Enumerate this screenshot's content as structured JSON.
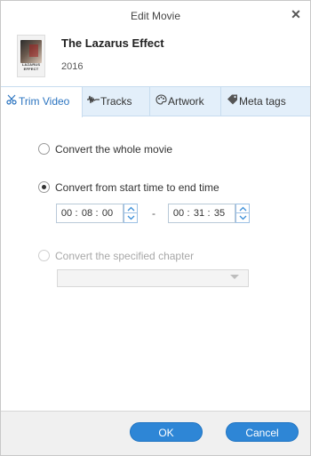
{
  "window": {
    "title": "Edit Movie",
    "close_icon": "close-icon"
  },
  "movie": {
    "title": "The Lazarus Effect",
    "year": "2016",
    "poster_text": "LAZARUS EFFECT"
  },
  "tabs": [
    {
      "label": "Trim Video",
      "icon": "scissors-icon",
      "active": true
    },
    {
      "label": "Tracks",
      "icon": "waveform-icon",
      "active": false
    },
    {
      "label": "Artwork",
      "icon": "palette-icon",
      "active": false
    },
    {
      "label": "Meta tags",
      "icon": "tag-icon",
      "active": false
    }
  ],
  "trim": {
    "options": [
      {
        "label": "Convert the whole movie",
        "checked": false,
        "enabled": true
      },
      {
        "label": "Convert from start time to end time",
        "checked": true,
        "enabled": true
      },
      {
        "label": "Convert the specified chapter",
        "checked": false,
        "enabled": false
      }
    ],
    "start": {
      "h": "00",
      "m": "08",
      "s": "00"
    },
    "end": {
      "h": "00",
      "m": "31",
      "s": "35"
    },
    "separator": "-",
    "chapter_value": ""
  },
  "footer": {
    "ok_label": "OK",
    "cancel_label": "Cancel"
  },
  "colors": {
    "accent": "#2e86d6",
    "tab_bar": "#e3effa",
    "active_tab_text": "#2b74c0"
  }
}
